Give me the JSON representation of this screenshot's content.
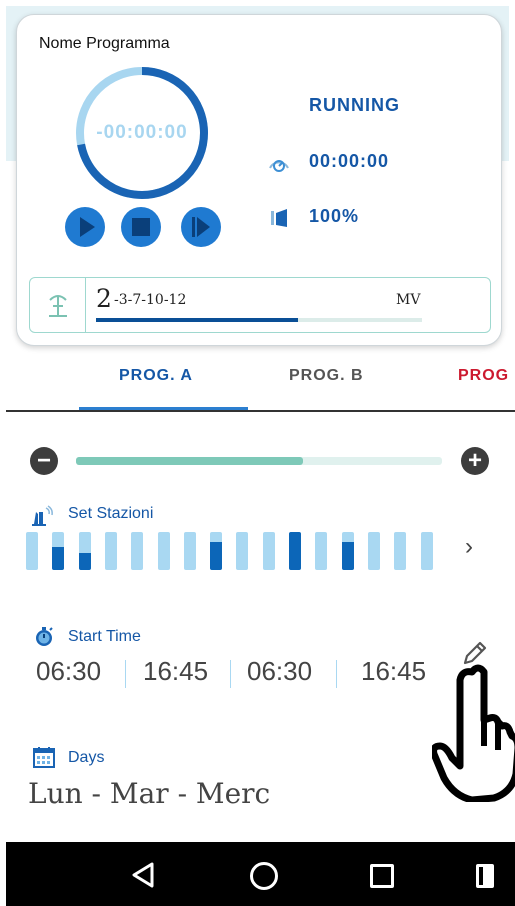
{
  "program_card": {
    "name": "Nome Programma",
    "countdown": "-00:00:00",
    "ring_progress": 0.72,
    "status": "RUNNING",
    "elapsed": "00:00:00",
    "percentage": "100%",
    "controls": {
      "play": "play-icon",
      "stop": "stop-icon",
      "next": "skip-next-icon"
    },
    "station": {
      "current": "2",
      "sequence": "-3-7-10-12",
      "mode": "MV",
      "progress": 0.62
    }
  },
  "tabs": [
    {
      "label": "PROG. A",
      "active": true
    },
    {
      "label": "PROG. B",
      "active": false
    },
    {
      "label": "PROG",
      "active": false
    }
  ],
  "slider": {
    "value": 0.62
  },
  "set_stations": {
    "label": "Set Stazioni",
    "levels": [
      0,
      0.6,
      0.45,
      0,
      0,
      0,
      0,
      0.75,
      0,
      0,
      1.0,
      0,
      0.75,
      0,
      0,
      0
    ]
  },
  "start_time": {
    "label": "Start Time",
    "times": [
      "06:30",
      "16:45",
      "06:30",
      "16:45"
    ]
  },
  "days": {
    "label": "Days",
    "value": "Lun - Mar - Merc"
  },
  "colors": {
    "accent": "#1557a6",
    "button": "#1f7ad1",
    "station_light": "#a9d8f2",
    "station_dark": "#0c66b8",
    "tab_c": "#cc1a2f"
  }
}
